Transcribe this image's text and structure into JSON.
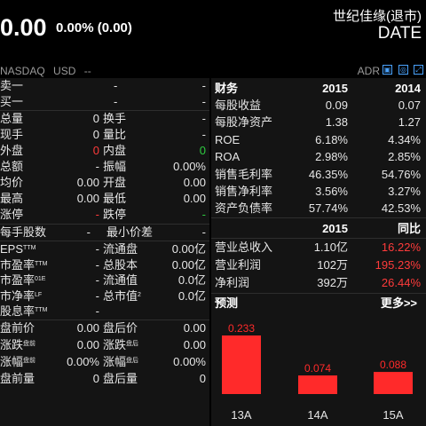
{
  "header": {
    "price": "0.00",
    "change": "0.00% (0.00)",
    "stock_name": "世纪佳缘(退市)",
    "date": "DATE",
    "market": "NASDAQ",
    "currency": "USD",
    "market_extra": "--",
    "adr": "ADR"
  },
  "order_book": {
    "sell1": {
      "label": "卖一",
      "value": "-",
      "volume": "-"
    },
    "buy1": {
      "label": "买一",
      "value": "-",
      "volume": "-"
    }
  },
  "stats": [
    {
      "l1": "总量",
      "v1": "0",
      "l2": "换手",
      "v2": "-"
    },
    {
      "l1": "现手",
      "v1": "0",
      "l2": "量比",
      "v2": "-"
    },
    {
      "l1": "外盘",
      "v1": "0",
      "l2": "内盘",
      "v2": "0"
    },
    {
      "l1": "总额",
      "v1": "-",
      "l2": "振幅",
      "v2": "0.00%"
    },
    {
      "l1": "均价",
      "v1": "0.00",
      "l2": "开盘",
      "v2": "0.00"
    },
    {
      "l1": "最高",
      "v1": "0.00",
      "l2": "最低",
      "v2": "0.00"
    },
    {
      "l1": "涨停",
      "v1": "-",
      "l2": "跌停",
      "v2": "-"
    }
  ],
  "lot": {
    "l1": "每手股数",
    "v1": "-",
    "l2": "最小价差",
    "v2": "-"
  },
  "valuation": [
    {
      "l1": "EPS",
      "s1": "TTM",
      "v1": "-",
      "l2": "流通盘",
      "s2": "",
      "v2": "0.00亿"
    },
    {
      "l1": "市盈率",
      "s1": "TTM",
      "v1": "-",
      "l2": "总股本",
      "s2": "",
      "v2": "0.00亿"
    },
    {
      "l1": "市盈率",
      "s1": "01E",
      "v1": "-",
      "l2": "流通值",
      "s2": "",
      "v2": "0.0亿"
    },
    {
      "l1": "市净率",
      "s1": "LF",
      "v1": "-",
      "l2": "总市值",
      "s2": "2",
      "v2": "0.0亿"
    },
    {
      "l1": "股息率",
      "s1": "TTM",
      "v1": "-",
      "l2": "",
      "s2": "",
      "v2": ""
    }
  ],
  "extended": [
    {
      "l1": "盘前价",
      "s1": "",
      "v1": "0.00",
      "l2": "盘后价",
      "s2": "",
      "v2": "0.00"
    },
    {
      "l1": "涨跌",
      "s1": "盘前",
      "v1": "0.00",
      "l2": "涨跌",
      "s2": "盘后",
      "v2": "0.00"
    },
    {
      "l1": "涨幅",
      "s1": "盘前",
      "v1": "0.00%",
      "l2": "涨幅",
      "s2": "盘后",
      "v2": "0.00%"
    },
    {
      "l1": "盘前量",
      "s1": "",
      "v1": "0",
      "l2": "盘后量",
      "s2": "",
      "v2": "0"
    }
  ],
  "finance": {
    "title": "财务",
    "col1": "2015",
    "col2": "2014",
    "rows": [
      {
        "label": "每股收益",
        "a": "0.09",
        "b": "0.07"
      },
      {
        "label": "每股净资产",
        "a": "1.38",
        "b": "1.27"
      },
      {
        "label": "ROE",
        "a": "6.18%",
        "b": "4.34%"
      },
      {
        "label": "ROA",
        "a": "2.98%",
        "b": "2.85%"
      },
      {
        "label": "销售毛利率",
        "a": "46.35%",
        "b": "54.76%"
      },
      {
        "label": "销售净利率",
        "a": "3.56%",
        "b": "3.27%"
      },
      {
        "label": "资产负债率",
        "a": "57.74%",
        "b": "42.53%"
      }
    ]
  },
  "income": {
    "col1": "2015",
    "col2": "同比",
    "rows": [
      {
        "label": "营业总收入",
        "a": "1.10亿",
        "b": "16.22%"
      },
      {
        "label": "营业利润",
        "a": "102万",
        "b": "195.23%"
      },
      {
        "label": "净利润",
        "a": "392万",
        "b": "26.44%"
      }
    ]
  },
  "forecast": {
    "title": "预测",
    "more": "更多>>"
  },
  "colors": {
    "up": "#ff3b3b",
    "down": "#2ecc40",
    "bar": "#ff2a2a"
  },
  "chart_data": {
    "type": "bar",
    "categories": [
      "13A",
      "14A",
      "15A"
    ],
    "values": [
      0.233,
      0.074,
      0.088
    ],
    "data_labels": [
      "0.233",
      "0.074",
      "0.088"
    ],
    "title": "",
    "xlabel": "",
    "ylabel": "",
    "ylim": [
      0,
      0.233
    ]
  }
}
